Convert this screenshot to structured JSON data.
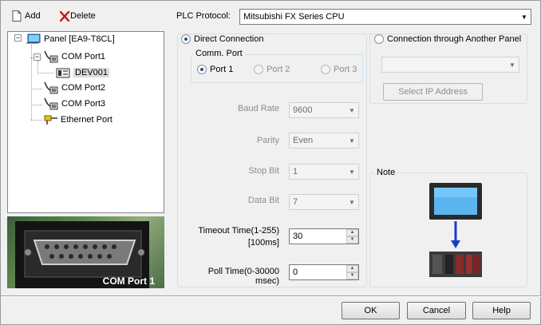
{
  "toolbar": {
    "add_label": "Add",
    "delete_label": "Delete"
  },
  "tree": {
    "items": [
      {
        "label": "Panel [EA9-T8CL]",
        "icon": "panel-icon"
      },
      {
        "label": "COM Port1",
        "icon": "com-port-icon"
      },
      {
        "label": "DEV001",
        "icon": "device-icon"
      },
      {
        "label": "COM Port2",
        "icon": "com-port-icon"
      },
      {
        "label": "COM Port3",
        "icon": "com-port-icon"
      },
      {
        "label": "Ethernet Port",
        "icon": "ethernet-port-icon"
      }
    ]
  },
  "preview": {
    "caption": "COM Port 1"
  },
  "protocol": {
    "label": "PLC Protocol:",
    "value": "Mitsubishi FX Series CPU"
  },
  "direct": {
    "label": "Direct Connection",
    "comm_port": {
      "title": "Comm. Port",
      "ports": [
        "Port 1",
        "Port 2",
        "Port 3"
      ],
      "selected": "Port 1"
    },
    "fields": {
      "baud_label": "Baud Rate",
      "baud_value": "9600",
      "parity_label": "Parity",
      "parity_value": "Even",
      "stop_label": "Stop Bit",
      "stop_value": "1",
      "data_label": "Data Bit",
      "data_value": "7",
      "timeout_label_1": "Timeout Time(1-255)",
      "timeout_label_2": "[100ms]",
      "timeout_value": "30",
      "poll_label": "Poll Time(0-30000 msec)",
      "poll_value": "0"
    }
  },
  "another": {
    "label": "Connection through Another Panel",
    "select_ip_label": "Select IP Address"
  },
  "note": {
    "title": "Note"
  },
  "buttons": {
    "ok": "OK",
    "cancel": "Cancel",
    "help": "Help"
  },
  "colors": {
    "accent": "#1e4f9a",
    "arrow": "#1a3cc8",
    "panel_screen": "#5ab4f0"
  }
}
